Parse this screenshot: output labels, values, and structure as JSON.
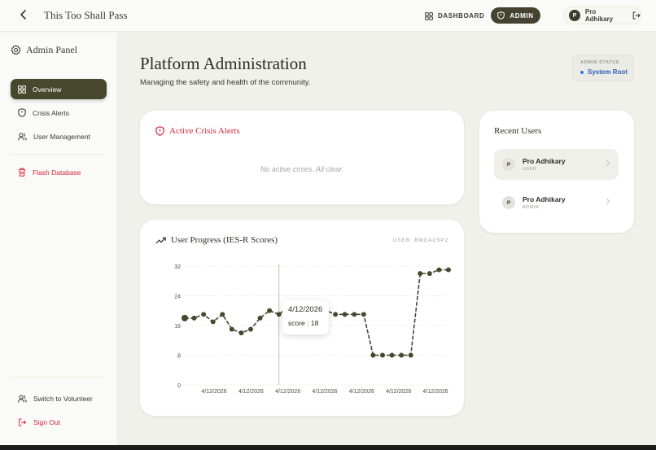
{
  "header": {
    "app_title": "This Too Shall Pass",
    "nav": {
      "dashboard": "DASHBOARD",
      "admin": "ADMIN"
    },
    "user": {
      "initial": "P",
      "name": "Pro Adhikary"
    }
  },
  "sidebar": {
    "title": "Admin Panel",
    "items": [
      {
        "label": "Overview",
        "icon": "grid-icon"
      },
      {
        "label": "Crisis Alerts",
        "icon": "shield-icon"
      },
      {
        "label": "User Management",
        "icon": "users-icon"
      }
    ],
    "danger_item": {
      "label": "Flash Database",
      "icon": "trash-icon"
    },
    "bottom_items": [
      {
        "label": "Switch to Volunteer",
        "icon": "users-icon"
      },
      {
        "label": "Sign Out",
        "icon": "logout-icon"
      }
    ]
  },
  "main": {
    "title": "Platform Administration",
    "subtitle": "Managing the safety and health of the community.",
    "status": {
      "label": "ADMIN STATUS",
      "value": "System Root"
    }
  },
  "crisis": {
    "title": "Active Crisis Alerts",
    "empty": "No active crises. All clear."
  },
  "recent_users": {
    "title": "Recent Users",
    "users": [
      {
        "initial": "P",
        "name": "Pro Adhikary",
        "role": "USER"
      },
      {
        "initial": "P",
        "name": "Pro Adhikary",
        "role": "ADMIN"
      }
    ]
  },
  "progress": {
    "title": "User Progress (IES-R Scores)",
    "user": "USER: BMGAC9P2",
    "tooltip": {
      "date": "4/12/2026",
      "score": "score : 18"
    }
  },
  "colors": {
    "accent": "#48482f",
    "danger": "#d8263a",
    "status_blue": "#2f76e5"
  },
  "chart_data": {
    "type": "line",
    "title": "User Progress (IES-R Scores)",
    "xlabel": "",
    "ylabel": "",
    "ylim": [
      0,
      32
    ],
    "yticks": [
      0,
      8,
      16,
      24,
      32
    ],
    "xtick_labels": [
      "4/12/2026",
      "4/12/2026",
      "4/12/2026",
      "4/12/2026",
      "4/12/2026",
      "4/12/2026",
      "4/12/2026"
    ],
    "grid": true,
    "series": [
      {
        "values": [
          18,
          18,
          19,
          17,
          19,
          15,
          14,
          15,
          18,
          20,
          19,
          21,
          20,
          20,
          20,
          20,
          19,
          19,
          19,
          19,
          8,
          8,
          8,
          8,
          8,
          30,
          30,
          31,
          31
        ]
      }
    ],
    "highlight_index": 10
  }
}
